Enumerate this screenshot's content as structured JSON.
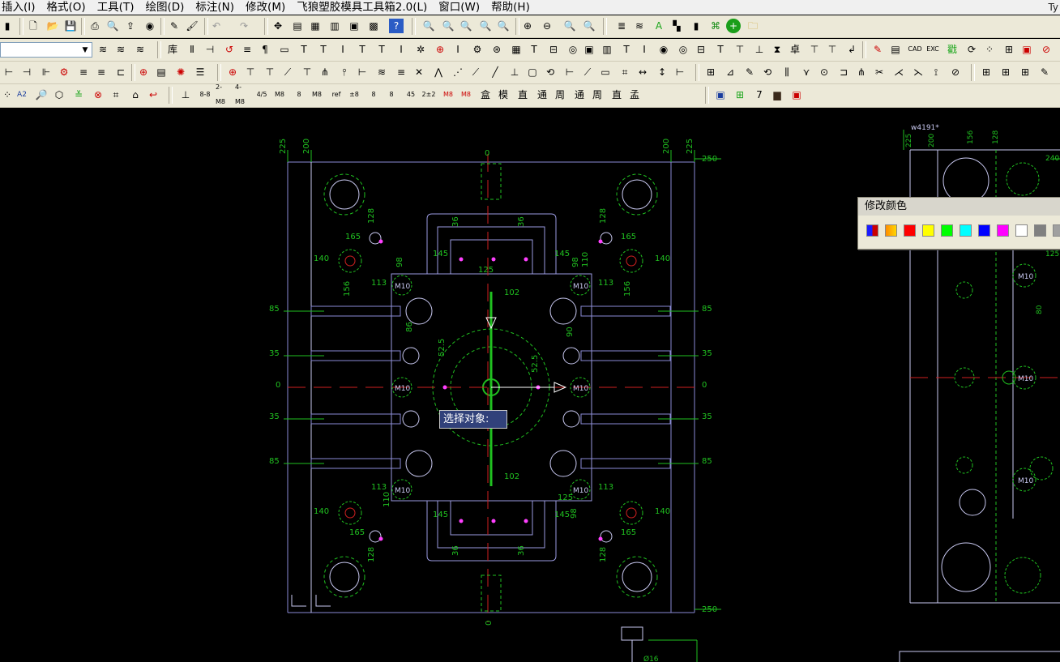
{
  "menubar": {
    "items": [
      "插入(I)",
      "格式(O)",
      "工具(T)",
      "绘图(D)",
      "标注(N)",
      "修改(M)",
      "飞狼塑胶模具工具箱2.0(L)",
      "窗口(W)",
      "帮助(H)"
    ],
    "title_right": "Ty"
  },
  "toolbar2": {
    "glyphs": [
      "库",
      "Ⅱ",
      "⊣",
      "↺",
      "≡",
      "¶",
      "▭",
      "T",
      "T",
      "I",
      "T",
      "T",
      "I",
      "I",
      "T",
      "T",
      "I",
      "T"
    ]
  },
  "toolbar3": {
    "glyphs": [
      "⊢",
      "⊣",
      "⊩",
      "⚙",
      "≡",
      "≡",
      "⊕",
      "⊕",
      "⊕",
      "⊤",
      "≋",
      "⊞",
      "⊞",
      "⊞",
      "⊞"
    ]
  },
  "toolbar4": {
    "glyphs": [
      "A2",
      "8-8",
      "2-M8",
      "4-M8",
      "4/5",
      "M8",
      "8",
      "ref",
      "±8",
      "8",
      "8",
      "45",
      "2±2",
      "M8",
      "M8",
      "盒",
      "模",
      "直",
      "通",
      "周",
      "直",
      "孟"
    ]
  },
  "color_panel": {
    "title": "修改颜色",
    "swatches": [
      "#1a1aff",
      "#ff8c00",
      "#ff0000",
      "#ffff00",
      "#00ff00",
      "#00ffff",
      "#0000ff",
      "#ff00ff",
      "#ffffff",
      "#808080",
      "#a0a0a0"
    ]
  },
  "prompt": {
    "text": "选择对象:"
  },
  "drawing": {
    "dims_left_top": [
      "225",
      "200"
    ],
    "dims_right_top": [
      "200",
      "225"
    ],
    "center_top": "0",
    "center_bottom": "0",
    "edge_right_top": "250",
    "edge_right_bottom": "250",
    "left_row_labels": [
      "85",
      "35",
      "0",
      "35",
      "85"
    ],
    "right_row_labels": [
      "85",
      "35",
      "0",
      "35",
      "85"
    ],
    "labels": {
      "l165": "165",
      "l140": "140",
      "l128": "128",
      "l156": "156",
      "l113": "113",
      "l98": "98",
      "l110": "110",
      "r165": "165",
      "r140": "140",
      "r128": "128",
      "r156": "156",
      "r113": "113",
      "r98": "98",
      "r110": "110",
      "t36a": "36",
      "t36b": "36",
      "t145a": "145",
      "t145b": "145",
      "t125": "125",
      "t102": "102",
      "b36a": "36",
      "b36b": "36",
      "b145a": "145",
      "b145b": "145",
      "b125": "125",
      "b102": "102",
      "c525a": "52.5",
      "c525b": "52.5",
      "m10": "M10",
      "h90": "90",
      "h86": "86"
    },
    "right_view_labels": {
      "top": "w4191*",
      "d225": "225",
      "d200": "200",
      "d156": "156",
      "d128": "128",
      "d240": "240",
      "d125": "125",
      "d80": "80",
      "d016": "Ø16"
    }
  }
}
